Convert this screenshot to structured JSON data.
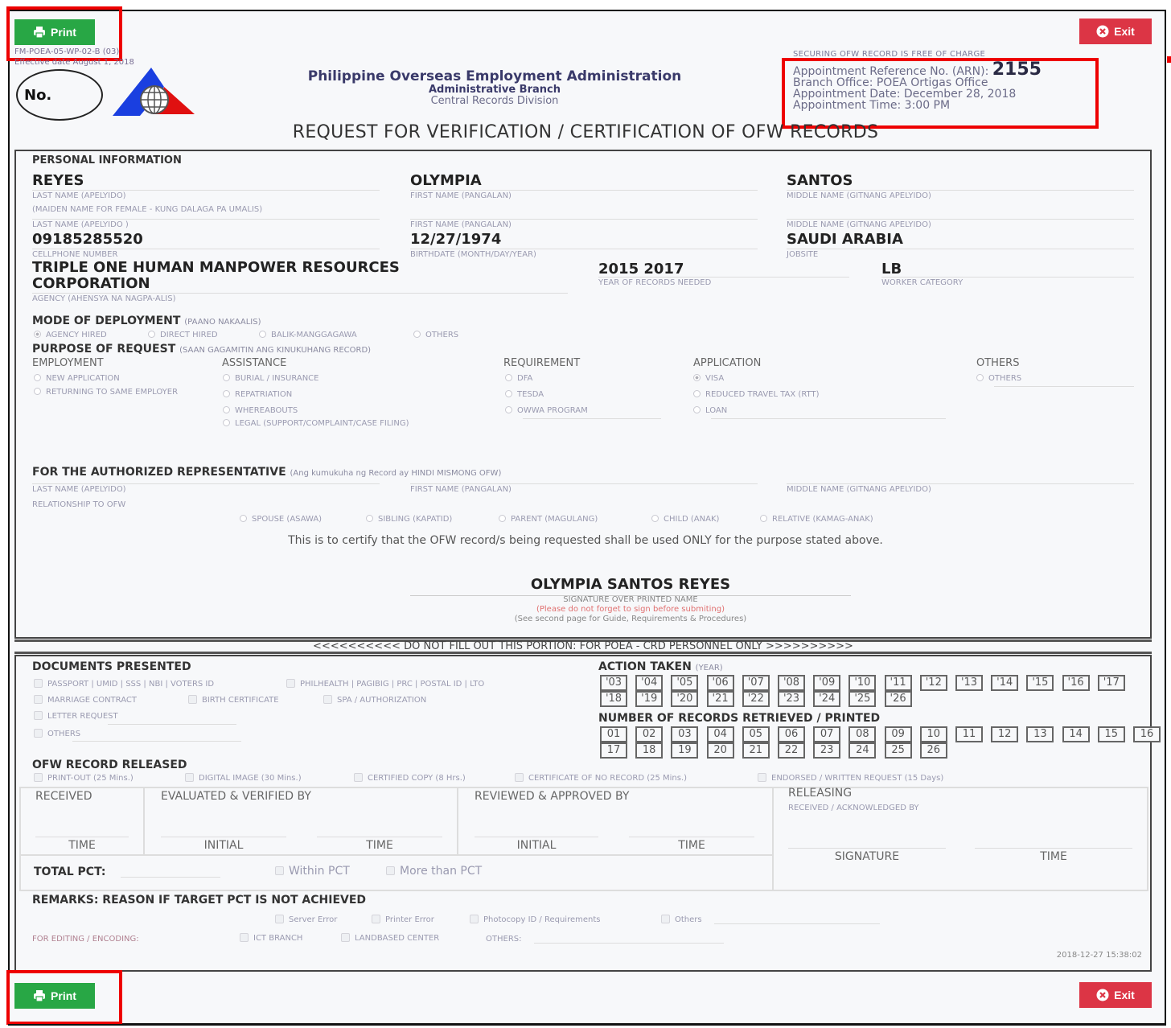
{
  "toolbar": {
    "print_label": "Print",
    "exit_label": "Exit",
    "print_icon": "printer-icon",
    "exit_icon": "close-circle-icon",
    "colors": {
      "print": "#28a745",
      "exit": "#dc3545",
      "highlight": "#ee0000"
    }
  },
  "header": {
    "form_code": "FM-POEA-05-WP-02-B (03)",
    "effectivity": "Effective date August 1, 2018",
    "no_label": "No.",
    "agency": "Philippine Overseas Employment Administration",
    "branch": "Administrative Branch",
    "division": "Central Records Division",
    "free_note": "SECURING OFW RECORD IS FREE OF CHARGE",
    "arn_label": "Appointment Reference No. (ARN):",
    "arn_value": "2155",
    "branch_office": "Branch Office: POEA Ortigas Office",
    "appointment_date": "Appointment Date: December 28, 2018",
    "appointment_time": "Appointment Time: 3:00 PM",
    "title": "REQUEST FOR VERIFICATION / CERTIFICATION OF OFW RECORDS"
  },
  "personal": {
    "heading": "PERSONAL INFORMATION",
    "last_name": "REYES",
    "last_name_cap": "LAST NAME (APELYIDO)",
    "first_name": "OLYMPIA",
    "first_name_cap": "FIRST NAME (PANGALAN)",
    "middle_name": "SANTOS",
    "middle_name_cap": "MIDDLE NAME (GITNANG APELYIDO)",
    "maiden_note": "(MAIDEN NAME FOR FEMALE - KUNG DALAGA PA UMALIS)",
    "maiden_last_cap": "LAST NAME (APELYIDO )",
    "maiden_first_cap": "FIRST NAME (PANGALAN)",
    "maiden_middle_cap": "MIDDLE NAME (GITNANG APELYIDO)",
    "cellphone": "09185285520",
    "cellphone_cap": "CELLPHONE NUMBER",
    "birthdate": "12/27/1974",
    "birthdate_cap": "BIRTHDATE (MONTH/DAY/YEAR)",
    "jobsite": "SAUDI ARABIA",
    "jobsite_cap": "JOBSITE",
    "agency_line1": "TRIPLE ONE HUMAN MANPOWER RESOURCES",
    "agency_line2": "CORPORATION",
    "agency_cap": "AGENCY (AHENSYA NA NAGPA-ALIS)",
    "years": "2015 2017",
    "years_cap": "YEAR OF RECORDS NEEDED",
    "category": "LB",
    "category_cap": "WORKER CATEGORY"
  },
  "deployment": {
    "heading": "MODE OF DEPLOYMENT",
    "sub": "(PAANO NAKAALIS)",
    "options": [
      {
        "label": "AGENCY HIRED",
        "selected": true
      },
      {
        "label": "DIRECT HIRED",
        "selected": false
      },
      {
        "label": "BALIK-MANGGAGAWA",
        "selected": false
      },
      {
        "label": "OTHERS",
        "selected": false
      }
    ]
  },
  "purpose": {
    "heading": "PURPOSE OF REQUEST",
    "sub": "(SAAN GAGAMITIN ANG KINUKUHANG RECORD)",
    "employment": {
      "title": "EMPLOYMENT",
      "options": [
        "NEW APPLICATION",
        "RETURNING TO SAME EMPLOYER"
      ]
    },
    "assistance": {
      "title": "ASSISTANCE",
      "options": [
        "BURIAL / INSURANCE",
        "REPATRIATION",
        "WHEREABOUTS",
        "LEGAL (SUPPORT/COMPLAINT/CASE FILING)"
      ]
    },
    "requirement": {
      "title": "REQUIREMENT",
      "options": [
        "DFA",
        "TESDA",
        "OWWA PROGRAM"
      ]
    },
    "application": {
      "title": "APPLICATION",
      "options": [
        "VISA",
        "REDUCED TRAVEL TAX (RTT)",
        "LOAN"
      ],
      "selected": "VISA"
    },
    "others": {
      "title": "OTHERS",
      "options": [
        "OTHERS"
      ]
    }
  },
  "representative": {
    "heading": "FOR THE AUTHORIZED REPRESENTATIVE",
    "sub": "(Ang kumukuha ng Record ay HINDI MISMONG OFW)",
    "last_cap": "LAST NAME (APELYIDO)",
    "first_cap": "FIRST NAME (PANGALAN)",
    "middle_cap": "MIDDLE NAME (GITNANG APELYIDO)",
    "relationship_cap": "RELATIONSHIP TO OFW",
    "relationships": [
      "SPOUSE (ASAWA)",
      "SIBLING (KAPATID)",
      "PARENT (MAGULANG)",
      "CHILD (ANAK)",
      "RELATIVE (KAMAG-ANAK)"
    ]
  },
  "certify": "This is to certify that the OFW record/s being requested shall be used ONLY for the purpose stated above.",
  "signature": {
    "name": "OLYMPIA SANTOS REYES",
    "caption": "SIGNATURE OVER PRINTED NAME",
    "reminder": "(Please do not forget to sign before submiting)",
    "guide": "(See second page for Guide, Requirements & Procedures)"
  },
  "poea_banner": "<<<<<<<<<< DO NOT FILL OUT THIS PORTION: FOR POEA - CRD PERSONNEL ONLY >>>>>>>>>>",
  "documents": {
    "heading": "DOCUMENTS PRESENTED",
    "row1": [
      "PASSPORT | UMID | SSS | NBI | VOTERS ID",
      "PHILHEALTH | PAGIBIG | PRC | POSTAL ID | LTO"
    ],
    "row2": [
      "MARRIAGE CONTRACT",
      "BIRTH CERTIFICATE",
      "SPA / AUTHORIZATION"
    ],
    "letter": "LETTER REQUEST",
    "others": "OTHERS"
  },
  "action_taken": {
    "heading": "ACTION TAKEN",
    "sub": "(YEAR)",
    "years": [
      "'03",
      "'04",
      "'05",
      "'06",
      "'07",
      "'08",
      "'09",
      "'10",
      "'11",
      "'12",
      "'13",
      "'14",
      "'15",
      "'16",
      "'17",
      "'18",
      "'19",
      "'20",
      "'21",
      "'22",
      "'23",
      "'24",
      "'25",
      "'26"
    ]
  },
  "records_retrieved": {
    "heading": "NUMBER OF RECORDS RETRIEVED / PRINTED",
    "numbers": [
      "01",
      "02",
      "03",
      "04",
      "05",
      "06",
      "07",
      "08",
      "09",
      "10",
      "11",
      "12",
      "13",
      "14",
      "15",
      "16",
      "17",
      "18",
      "19",
      "20",
      "21",
      "22",
      "23",
      "24",
      "25",
      "26"
    ]
  },
  "released": {
    "heading": "OFW RECORD RELEASED",
    "options": [
      "PRINT-OUT (25 Mins.)",
      "DIGITAL IMAGE (30 Mins.)",
      "CERTIFIED COPY (8 Hrs.)",
      "CERTIFICATE OF NO RECORD (25 Mins.)",
      "ENDORSED / WRITTEN REQUEST (15 Days)"
    ]
  },
  "processing": {
    "received": "RECEIVED",
    "evaluated": "EVALUATED & VERIFIED BY",
    "reviewed": "REVIEWED & APPROVED BY",
    "releasing": "RELEASING",
    "acknowledged": "RECEIVED / ACKNOWLEDGED BY",
    "time": "TIME",
    "initial": "INITIAL",
    "signature": "SIGNATURE",
    "total_pct": "TOTAL PCT:",
    "within_pct": "Within PCT",
    "more_pct": "More than PCT"
  },
  "remarks": {
    "heading": "REMARKS: REASON IF TARGET PCT IS NOT ACHIEVED",
    "reasons": [
      "Server Error",
      "Printer Error",
      "Photocopy ID / Requirements",
      "Others"
    ],
    "editing_label": "FOR EDITING / ENCODING:",
    "editing_options": [
      "ICT BRANCH",
      "LANDBASED CENTER"
    ],
    "editing_others": "OTHERS:"
  },
  "timestamp": "2018-12-27 15:38:02"
}
